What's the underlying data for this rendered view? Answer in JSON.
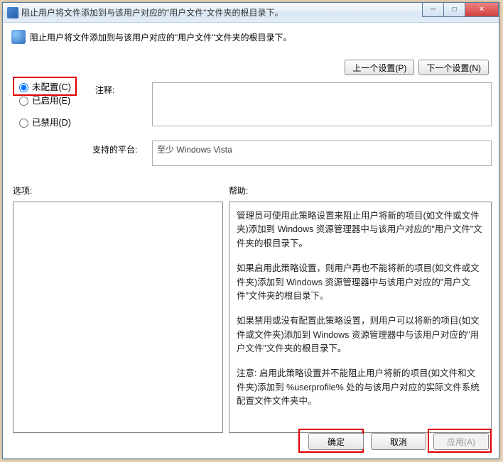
{
  "window": {
    "title": "阻止用户将文件添加到与该用户对应的\"用户文件\"文件夹的根目录下。"
  },
  "header": {
    "text": "阻止用户将文件添加到与该用户对应的\"用户文件\"文件夹的根目录下。"
  },
  "nav": {
    "prev": "上一个设置(P)",
    "next": "下一个设置(N)"
  },
  "radios": {
    "not_configured": "未配置(C)",
    "enabled": "已启用(E)",
    "disabled": "已禁用(D)",
    "selected": "not_configured"
  },
  "labels": {
    "comment": "注释:",
    "platform": "支持的平台:",
    "options": "选项:",
    "help": "帮助:"
  },
  "platform_value": "至少 Windows Vista",
  "help_paragraphs": {
    "p1": "管理员可使用此策略设置来阻止用户将新的项目(如文件或文件夹)添加到 Windows 资源管理器中与该用户对应的\"用户文件\"文件夹的根目录下。",
    "p2": "如果启用此策略设置，则用户再也不能将新的项目(如文件或文件夹)添加到 Windows 资源管理器中与该用户对应的\"用户文件\"文件夹的根目录下。",
    "p3": "如果禁用或没有配置此策略设置，则用户可以将新的项目(如文件或文件夹)添加到 Windows 资源管理器中与该用户对应的\"用户文件\"文件夹的根目录下。",
    "p4": "注意: 启用此策略设置并不能阻止用户将新的项目(如文件和文件夹)添加到 %userprofile% 处的与该用户对应的实际文件系统配置文件文件夹中。"
  },
  "buttons": {
    "ok": "确定",
    "cancel": "取消",
    "apply": "应用(A)"
  }
}
